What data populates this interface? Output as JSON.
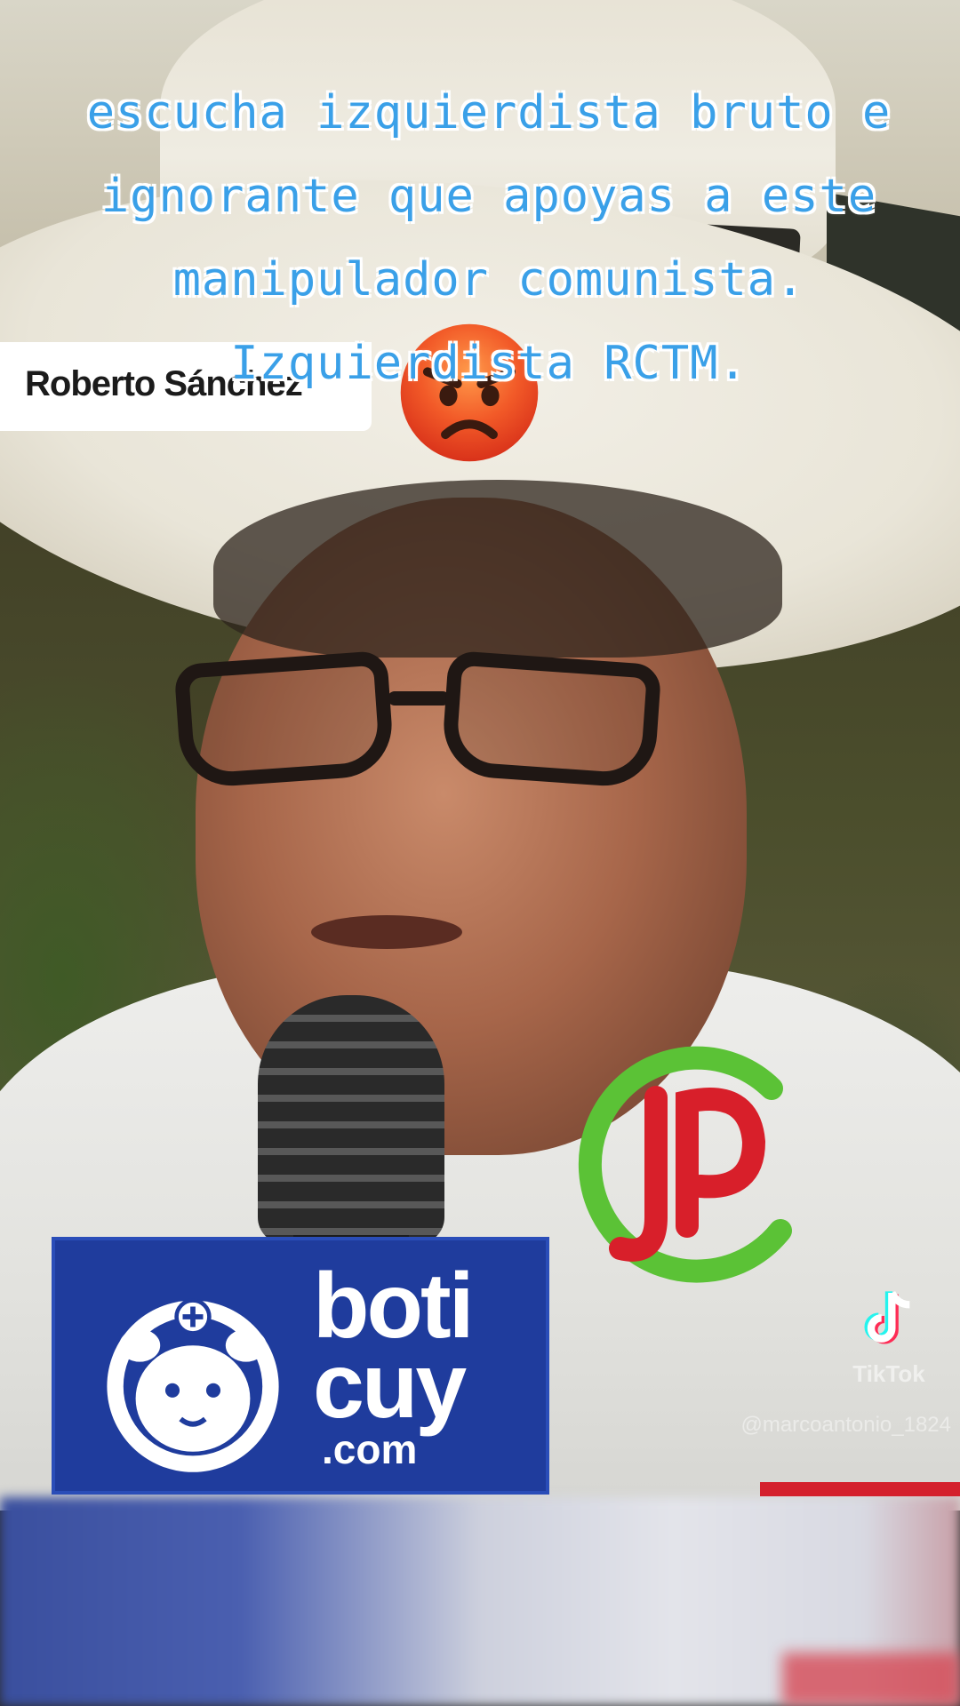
{
  "caption": {
    "lines": [
      "escucha izquierdista bruto e",
      "ignorante que apoyas a este",
      "manipulador comunista.",
      "Izquierdista RCTM."
    ],
    "color": "#3aa0e8"
  },
  "name_tag": {
    "text": "Roberto Sánchez"
  },
  "emoji": {
    "icon": "angry-face-emoji"
  },
  "watermark_logo": {
    "text": "JP",
    "ring_color": "#5bc236",
    "letter_color": "#d81f2a"
  },
  "sponsor": {
    "line1": "boti",
    "line2": "cuy",
    "line3": ".com",
    "background": "#1f3c9d"
  },
  "tiktok": {
    "label": "TikTok",
    "handle": "@marcoantonio_1824"
  }
}
